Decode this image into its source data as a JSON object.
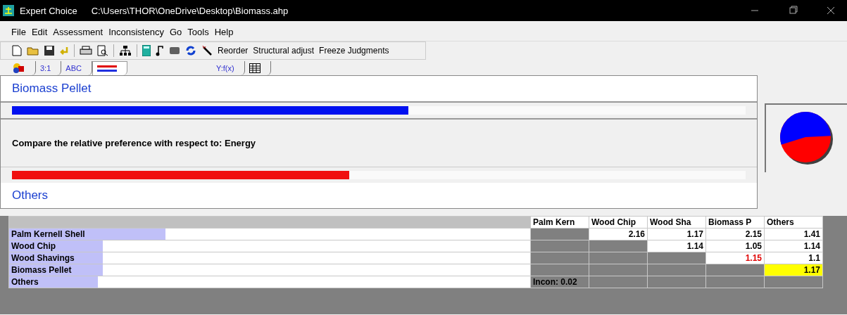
{
  "window": {
    "app": "Expert Choice",
    "path": "C:\\Users\\THOR\\OneDrive\\Desktop\\Biomass.ahp"
  },
  "menu": [
    "File",
    "Edit",
    "Assessment",
    "Inconsistency",
    "Go",
    "Tools",
    "Help"
  ],
  "toolbar": {
    "text_buttons": [
      "Reorder",
      "Structural adjust",
      "Freeze Judgments"
    ]
  },
  "tabs": [
    {
      "kind": "shapes",
      "selected": false
    },
    {
      "kind": "text",
      "label": "3:1",
      "selected": false
    },
    {
      "kind": "text",
      "label": "ABC",
      "selected": false
    },
    {
      "kind": "bars",
      "selected": true
    },
    {
      "kind": "text",
      "label": "Y:f(x)",
      "selected": false
    },
    {
      "kind": "grid",
      "selected": false
    }
  ],
  "comparison": {
    "top_item": "Biomass Pellet",
    "top_bar": {
      "level": 0.54
    },
    "prompt": "Compare the relative preference  with respect to: Energy",
    "bottom_bar": {
      "level": 0.46
    },
    "bottom_item": "Others"
  },
  "matrix": {
    "columns": [
      "Palm Kern",
      "Wood Chip",
      "Wood Sha",
      "Biomass P",
      "Others"
    ],
    "rows": [
      {
        "name": "Palm Kernell Shell",
        "level": 0.3,
        "cells": [
          {
            "kind": "blank"
          },
          {
            "kind": "value",
            "text": "2.16",
            "inverse": false,
            "selected": false
          },
          {
            "kind": "value",
            "text": "1.17",
            "inverse": false,
            "selected": false
          },
          {
            "kind": "value",
            "text": "2.15",
            "inverse": false,
            "selected": false
          },
          {
            "kind": "value",
            "text": "1.41",
            "inverse": false,
            "selected": false
          }
        ]
      },
      {
        "name": "Wood Chip",
        "level": 0.18,
        "cells": [
          {
            "kind": "blank"
          },
          {
            "kind": "blank"
          },
          {
            "kind": "value",
            "text": "1.14",
            "inverse": false,
            "selected": false
          },
          {
            "kind": "value",
            "text": "1.05",
            "inverse": false,
            "selected": false
          },
          {
            "kind": "value",
            "text": "1.14",
            "inverse": false,
            "selected": false
          }
        ]
      },
      {
        "name": "Wood Shavings",
        "level": 0.18,
        "cells": [
          {
            "kind": "blank"
          },
          {
            "kind": "blank"
          },
          {
            "kind": "blank"
          },
          {
            "kind": "value",
            "text": "1.15",
            "inverse": true,
            "selected": false
          },
          {
            "kind": "value",
            "text": "1.1",
            "inverse": false,
            "selected": false
          }
        ]
      },
      {
        "name": "Biomass Pellet",
        "level": 0.18,
        "cells": [
          {
            "kind": "blank"
          },
          {
            "kind": "blank"
          },
          {
            "kind": "blank"
          },
          {
            "kind": "blank"
          },
          {
            "kind": "value",
            "text": "1.17",
            "inverse": false,
            "selected": true
          }
        ]
      },
      {
        "name": "Others",
        "level": 0.17,
        "cells": [
          {
            "kind": "note",
            "text": "Incon: 0.02"
          },
          {
            "kind": "blank"
          },
          {
            "kind": "blank"
          },
          {
            "kind": "blank"
          },
          {
            "kind": "blank"
          }
        ]
      }
    ]
  }
}
